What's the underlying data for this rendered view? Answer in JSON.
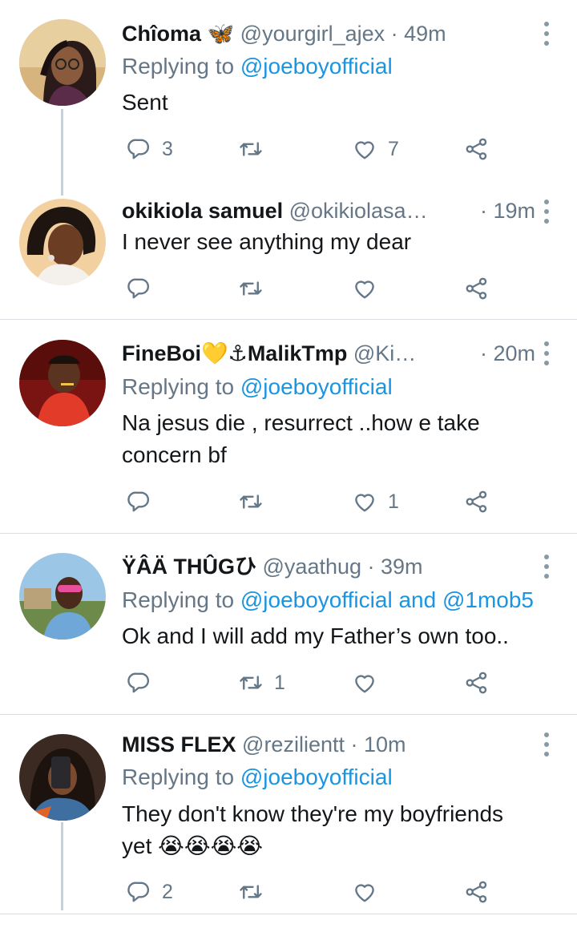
{
  "replying_label": "Replying to",
  "tweets": [
    {
      "name": "Chîoma 🦋",
      "handle": "@yourgirl_ajex",
      "sep": " · ",
      "time": "49m",
      "mentions": [
        "@joeboyofficial"
      ],
      "text": "Sent",
      "replies": "3",
      "retweets": "",
      "likes": "7"
    },
    {
      "name": "okikiola samuel",
      "handle": "@okikiolasa…",
      "sep": "· ",
      "time": "19m",
      "text": "I never see anything my dear",
      "replies": "",
      "retweets": "",
      "likes": ""
    },
    {
      "name": "FineBoi💛⚓MalikTmp",
      "handle": "@Ki…",
      "sep": "· ",
      "time": "20m",
      "mentions": [
        "@joeboyofficial"
      ],
      "text_line1": "Na jesus die , resurrect ..how e take",
      "text_line2": "concern bf",
      "replies": "",
      "retweets": "",
      "likes": "1"
    },
    {
      "name": "ŸÂÄ THÛG🔰",
      "name_display": "ŸÂÄ THÛGひ",
      "handle": "@yaathug",
      "sep": " · ",
      "time": "39m",
      "mentions": [
        "@joeboyofficial",
        "@1mob5"
      ],
      "mention_joiner": "and",
      "text": "Ok and I will add my Father’s own too..",
      "replies": "",
      "retweets": "1",
      "likes": ""
    },
    {
      "name": "MISS FLEX",
      "handle": "@rezilientt",
      "sep": " · ",
      "time": "10m",
      "mentions": [
        "@joeboyofficial"
      ],
      "text_line1": "They don't know they're my boyfriends",
      "text_line2": "yet",
      "emoji": [
        "😭",
        "😭",
        "😭",
        "😭"
      ],
      "replies": "2",
      "retweets": "",
      "likes": ""
    }
  ],
  "icons": {
    "reply": "reply-icon",
    "retweet": "retweet-icon",
    "like": "heart-icon",
    "share": "share-icon",
    "more": "more-vertical-icon"
  },
  "colors": {
    "mention": "#1b95e0",
    "secondary_text": "#657786",
    "icon": "#657786",
    "divider": "#d9dde1",
    "thread_line": "#c8d0d8"
  }
}
